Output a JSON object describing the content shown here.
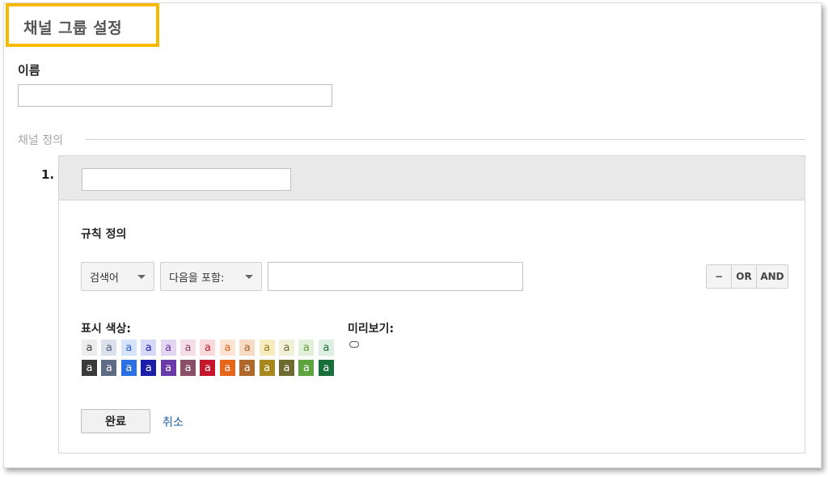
{
  "header": {
    "title": "채널 그룹 설정"
  },
  "name_field": {
    "label": "이름",
    "value": "",
    "placeholder": ""
  },
  "definition": {
    "section_label": "채널 정의"
  },
  "rule": {
    "number": "1.",
    "channel_name_value": "",
    "rule_title": "규칙 정의",
    "dimension_dropdown": "검색어",
    "match_dropdown": "다음을 포함:",
    "match_value": "",
    "buttons": {
      "remove": "−",
      "or": "OR",
      "and": "AND"
    },
    "color_label": "표시 색상:",
    "preview_label": "미리보기:",
    "swatch_letter": "a",
    "light_swatches": [
      {
        "bg": "#ececec",
        "fg": "#444444"
      },
      {
        "bg": "#dbe1ea",
        "fg": "#4a5a78"
      },
      {
        "bg": "#d5e3fb",
        "fg": "#2b62d9"
      },
      {
        "bg": "#d6d8f7",
        "fg": "#1a22b5"
      },
      {
        "bg": "#e2d6f2",
        "fg": "#6a35a8"
      },
      {
        "bg": "#f4dde6",
        "fg": "#8a4a62"
      },
      {
        "bg": "#f9d9dc",
        "fg": "#c0172a"
      },
      {
        "bg": "#fde3d2",
        "fg": "#e0611c"
      },
      {
        "bg": "#f6dcc4",
        "fg": "#a8622a"
      },
      {
        "bg": "#f6ecc0",
        "fg": "#9a7c16"
      },
      {
        "bg": "#f1f1da",
        "fg": "#6a6a2e"
      },
      {
        "bg": "#e1f0db",
        "fg": "#5d9a3c"
      },
      {
        "bg": "#dcefe2",
        "fg": "#1f6b37"
      }
    ],
    "dark_swatches": [
      {
        "bg": "#3a3a3a",
        "fg": "#ffffff"
      },
      {
        "bg": "#5d6c84",
        "fg": "#ffffff"
      },
      {
        "bg": "#2b6fe2",
        "fg": "#ffffff"
      },
      {
        "bg": "#1a1ea8",
        "fg": "#ffffff"
      },
      {
        "bg": "#6a3aa8",
        "fg": "#ffffff"
      },
      {
        "bg": "#8a4e66",
        "fg": "#ffffff"
      },
      {
        "bg": "#c4172c",
        "fg": "#ffffff"
      },
      {
        "bg": "#e8661a",
        "fg": "#ffffff"
      },
      {
        "bg": "#b0672a",
        "fg": "#ffffff"
      },
      {
        "bg": "#a8881c",
        "fg": "#ffffff"
      },
      {
        "bg": "#6e6a30",
        "fg": "#ffffff"
      },
      {
        "bg": "#5da43e",
        "fg": "#ffffff"
      },
      {
        "bg": "#17703a",
        "fg": "#ffffff"
      }
    ],
    "done_button": "완료",
    "cancel_link": "취소"
  }
}
